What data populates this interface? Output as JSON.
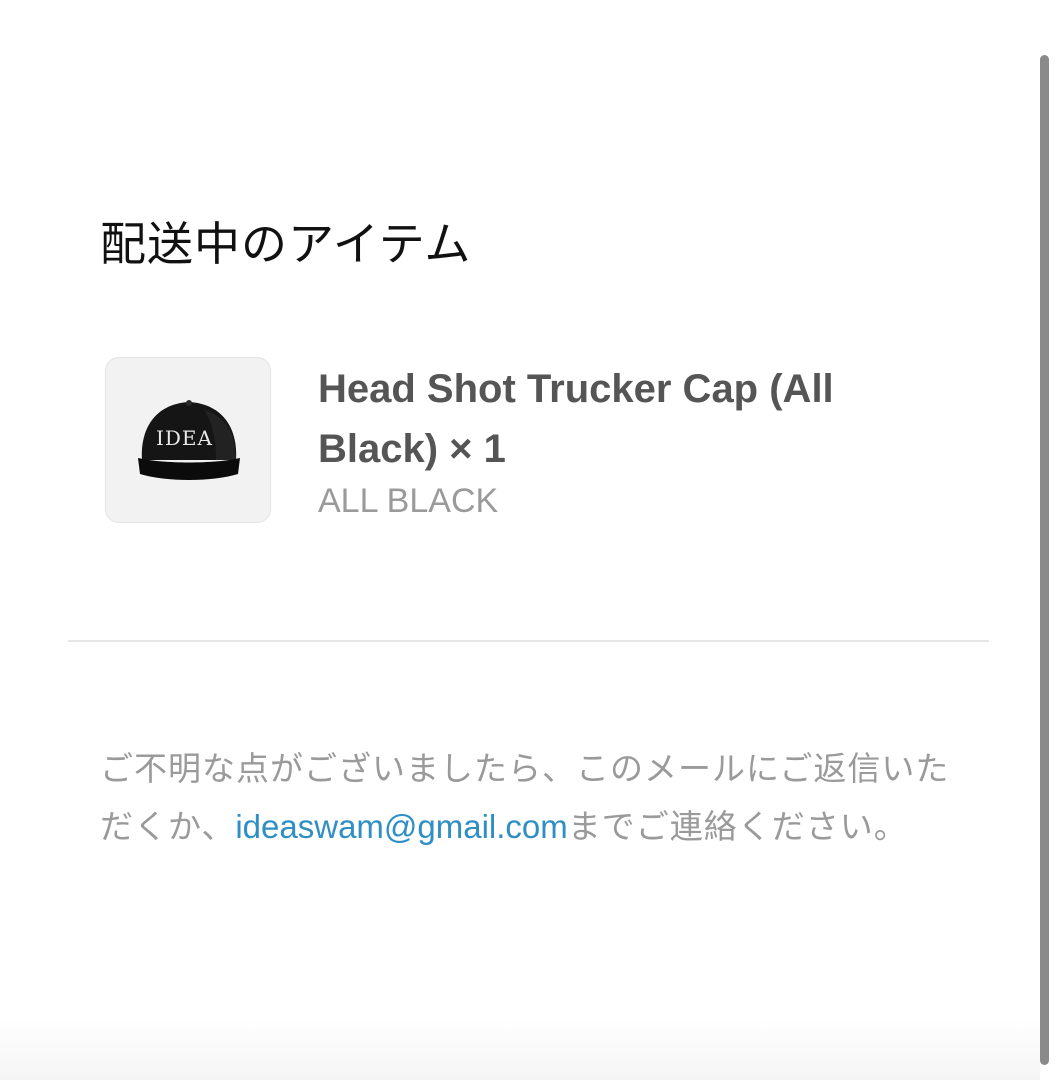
{
  "section": {
    "title": "配送中のアイテム"
  },
  "item": {
    "title": "Head Shot Trucker Cap (All Black) × 1",
    "variant": "ALL BLACK",
    "image_icon": "trucker-cap-image",
    "logo_text": "IDEA"
  },
  "footer": {
    "text_before": "ご不明な点がございましたら、このメールにご返信いただくか、",
    "email": "ideaswam@gmail.com",
    "text_after": "までご連絡ください。"
  },
  "colors": {
    "link": "#2f8fc4",
    "title": "#111111",
    "item_title": "#555555",
    "muted": "#9a9a9a"
  }
}
